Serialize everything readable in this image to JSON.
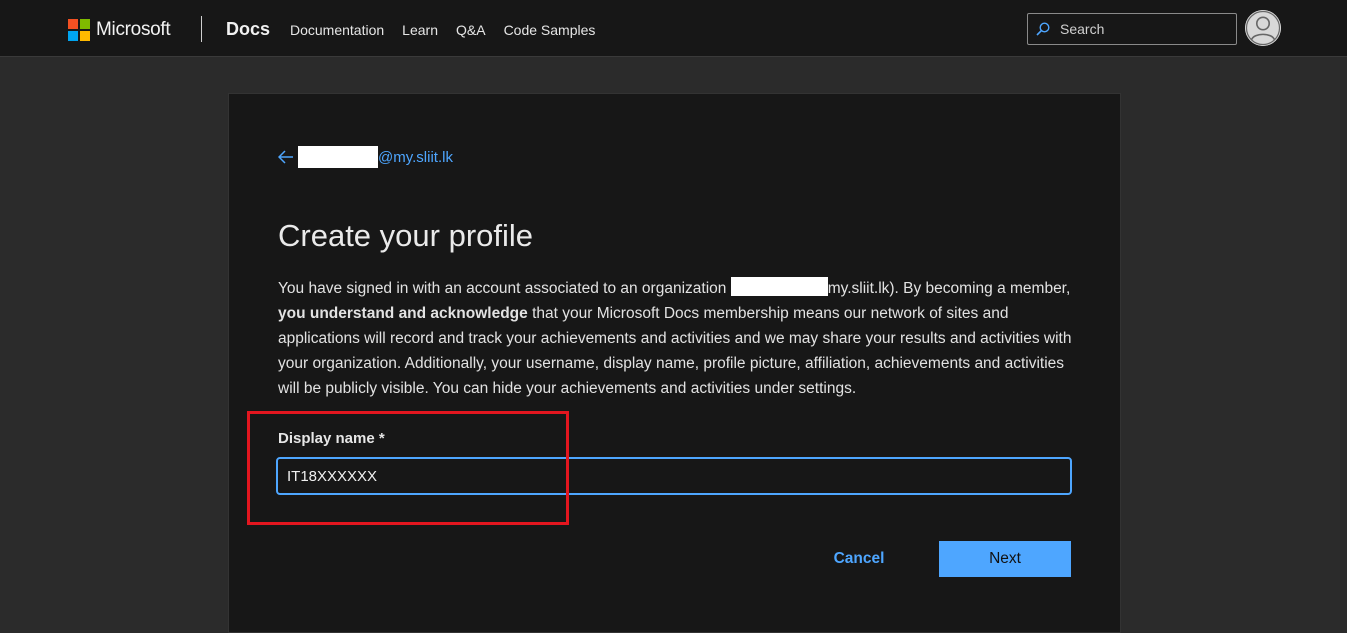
{
  "header": {
    "brand": "Microsoft",
    "site_title": "Docs",
    "nav": [
      {
        "label": "Documentation"
      },
      {
        "label": "Learn"
      },
      {
        "label": "Q&A"
      },
      {
        "label": "Code Samples"
      }
    ],
    "search_placeholder": "Search",
    "logo_colors": [
      "#f25022",
      "#7fba00",
      "#00a4ef",
      "#ffb900"
    ]
  },
  "profile": {
    "back_email_domain": "@my.sliit.lk",
    "heading": "Create your profile",
    "para_part1": "You have signed in with an account associated to an organization ",
    "para_part2": "my.sliit.lk). By becoming a member, ",
    "para_bold": "you understand and acknowledge",
    "para_part3": " that your Microsoft Docs membership means our network of sites and applications will record and track your achievements and activities and we may share your results and activities with your organization. Additionally, your username, display name, profile picture, affiliation, achievements and activities will be publicly visible. You can hide your achievements and activities under settings.",
    "display_name_label": "Display name *",
    "display_name_value": "IT18XXXXXX",
    "cancel_label": "Cancel",
    "next_label": "Next"
  },
  "colors": {
    "accent": "#4ea6ff",
    "highlight": "#e3161f",
    "background": "#2b2b2b",
    "card": "#171717"
  }
}
